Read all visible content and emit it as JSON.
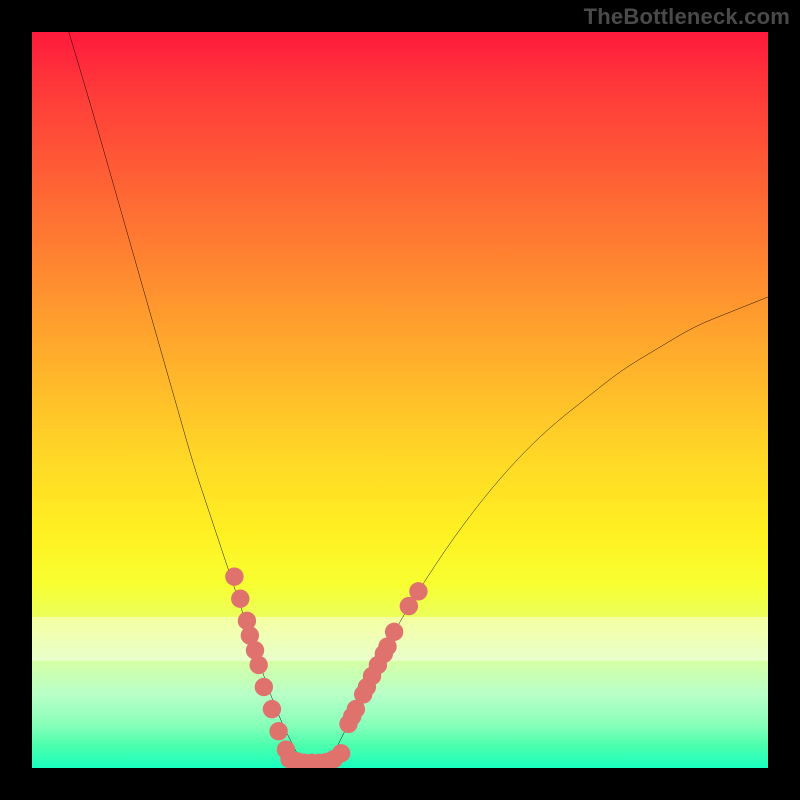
{
  "watermark": "TheBottleneck.com",
  "colors": {
    "curve": "#000000",
    "marker": "#e0726e",
    "background_black": "#000000"
  },
  "chart_data": {
    "type": "line",
    "title": "",
    "xlabel": "",
    "ylabel": "",
    "xlim": [
      0,
      100
    ],
    "ylim": [
      0,
      100
    ],
    "grid": false,
    "series": [
      {
        "name": "left-curve",
        "x": [
          5,
          8,
          12,
          16,
          20,
          22,
          24,
          26,
          28,
          30,
          32,
          34,
          35,
          36,
          37
        ],
        "y": [
          100,
          90,
          76,
          62,
          48,
          41,
          35,
          29,
          23,
          17,
          11,
          6,
          4,
          2,
          0
        ]
      },
      {
        "name": "right-curve",
        "x": [
          40,
          42,
          44,
          46,
          48,
          50,
          55,
          60,
          65,
          70,
          75,
          80,
          85,
          90,
          95,
          100
        ],
        "y": [
          0,
          4,
          8,
          12,
          16,
          20,
          28,
          35,
          41,
          46,
          50,
          54,
          57,
          60,
          62,
          64
        ]
      }
    ],
    "flat_segment": {
      "x": [
        35,
        40
      ],
      "y": 0
    },
    "markers_left": [
      {
        "x": 27.5,
        "y": 26
      },
      {
        "x": 28.3,
        "y": 23
      },
      {
        "x": 29.2,
        "y": 20
      },
      {
        "x": 29.6,
        "y": 18
      },
      {
        "x": 30.3,
        "y": 16
      },
      {
        "x": 30.8,
        "y": 14
      },
      {
        "x": 31.5,
        "y": 11
      },
      {
        "x": 32.6,
        "y": 8
      },
      {
        "x": 33.5,
        "y": 5
      },
      {
        "x": 34.5,
        "y": 2.5
      }
    ],
    "markers_right": [
      {
        "x": 43.0,
        "y": 6
      },
      {
        "x": 43.5,
        "y": 7
      },
      {
        "x": 44.0,
        "y": 8
      },
      {
        "x": 45.0,
        "y": 10
      },
      {
        "x": 45.5,
        "y": 11
      },
      {
        "x": 46.2,
        "y": 12.5
      },
      {
        "x": 47.0,
        "y": 14
      },
      {
        "x": 47.8,
        "y": 15.5
      },
      {
        "x": 48.3,
        "y": 16.5
      },
      {
        "x": 49.2,
        "y": 18.5
      },
      {
        "x": 51.2,
        "y": 22
      },
      {
        "x": 52.5,
        "y": 24
      }
    ],
    "markers_flat": [
      {
        "x": 35.0,
        "y": 1.2
      },
      {
        "x": 36.0,
        "y": 0.9
      },
      {
        "x": 37.0,
        "y": 0.7
      },
      {
        "x": 38.0,
        "y": 0.7
      },
      {
        "x": 39.0,
        "y": 0.7
      },
      {
        "x": 40.0,
        "y": 0.8
      },
      {
        "x": 41.0,
        "y": 1.2
      },
      {
        "x": 42.0,
        "y": 2.0
      }
    ]
  }
}
